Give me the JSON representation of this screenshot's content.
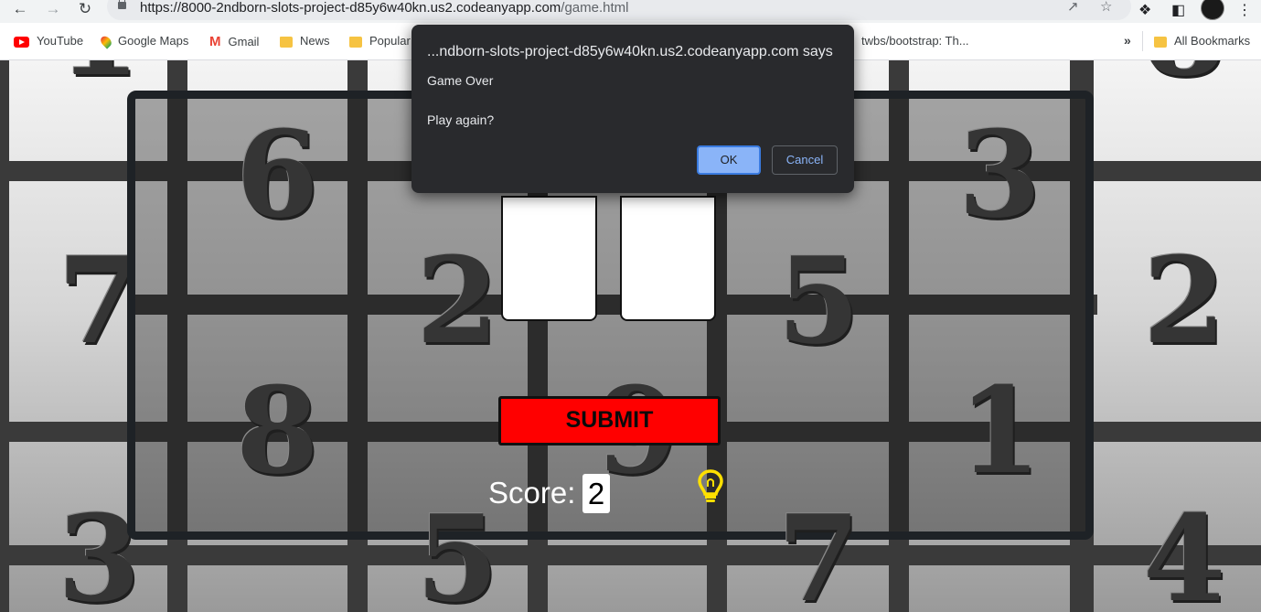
{
  "browser": {
    "url_main": "https://8000-2ndborn-slots-project-d85y6w40kn.us2.codeanyapp.com",
    "url_path": "/game.html",
    "bookmarks": [
      "YouTube",
      "Google Maps",
      "Gmail",
      "News",
      "Popular",
      "twbs/bootstrap: Th..."
    ],
    "bookmarks_more": "»",
    "all_bookmarks": "All Bookmarks",
    "icons": [
      "back-arrow-icon",
      "forward-arrow-icon",
      "reload-icon",
      "lock-icon",
      "share-icon",
      "star-icon",
      "puzzle-icon",
      "sidebar-icon",
      "avatar",
      "menu-icon"
    ]
  },
  "game": {
    "background_numbers": {
      "left_column": [
        "1",
        "7",
        "3"
      ],
      "right_column": [
        "8",
        "2",
        "4"
      ],
      "panel_col1": [
        "6",
        "8"
      ],
      "panel_col2": [
        "2",
        "5"
      ],
      "panel_col3": [
        "9"
      ],
      "panel_col4": [
        "5",
        "7"
      ],
      "panel_col5": [
        "3",
        "1"
      ]
    },
    "submit_label": "SUBMIT",
    "score_label": "Score:",
    "score_value": "2",
    "hint_icon": "lightbulb-icon",
    "colors": {
      "submit": "#ff0000",
      "bulb": "#ffe000",
      "panel_border": "#1e2226"
    }
  },
  "dialog": {
    "title": "...ndborn-slots-project-d85y6w40kn.us2.codeanyapp.com says",
    "message_line1": "Game Over",
    "message_line2": "Play again?",
    "ok_label": "OK",
    "cancel_label": "Cancel"
  }
}
